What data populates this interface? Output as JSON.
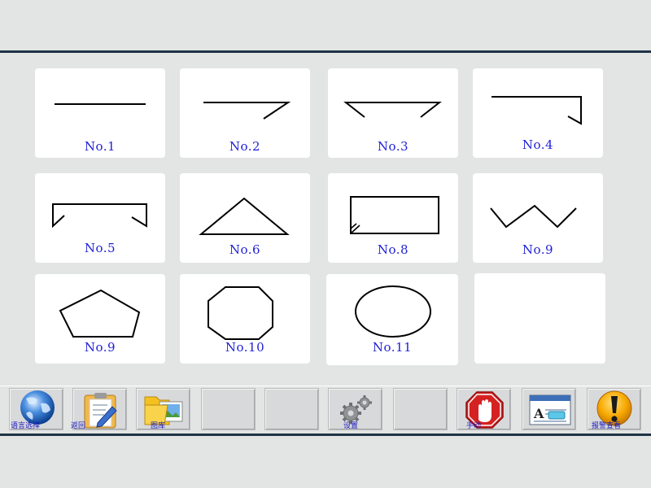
{
  "shapes": [
    {
      "label": "No.1"
    },
    {
      "label": "No.2"
    },
    {
      "label": "No.3"
    },
    {
      "label": "No.4"
    },
    {
      "label": "No.5"
    },
    {
      "label": "No.6"
    },
    {
      "label": "No.8"
    },
    {
      "label": "No.9"
    },
    {
      "label": "No.9"
    },
    {
      "label": "No.10"
    },
    {
      "label": "No.11"
    }
  ],
  "toolbar": {
    "language": "语言选择",
    "back": "返回",
    "gallery": "图库",
    "settings": "设置",
    "manual": "手动",
    "alarm": "报警查看"
  },
  "colors": {
    "label": "#1f1fd6",
    "frame_bar": "#1f3346",
    "background": "#e3e4e4"
  }
}
